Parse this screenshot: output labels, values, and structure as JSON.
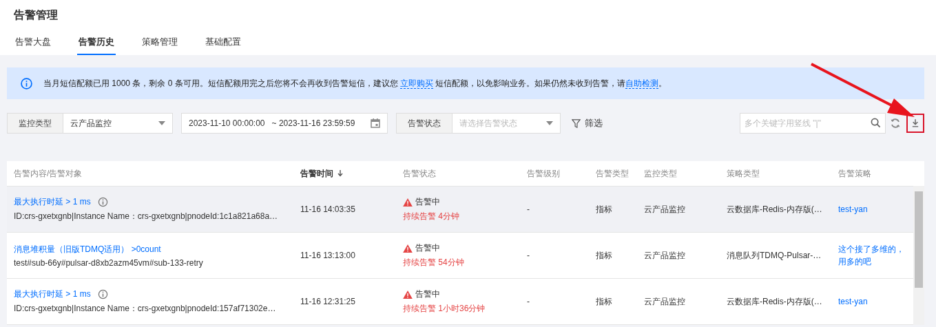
{
  "page_title": "告警管理",
  "tabs": [
    {
      "label": "告警大盘",
      "selected": false
    },
    {
      "label": "告警历史",
      "selected": true
    },
    {
      "label": "策略管理",
      "selected": false
    },
    {
      "label": "基础配置",
      "selected": false
    }
  ],
  "notice": {
    "text_1": "当月短信配额已用 1000 条，剩余 0 条可用。短信配额用完之后您将不会再收到告警短信，建议您 ",
    "link_1": "立即购买",
    "text_2": " 短信配额，以免影响业务。如果仍然未收到告警，请",
    "link_2": "自助检测",
    "text_3": "。"
  },
  "filters": {
    "monitor_type_label": "监控类型",
    "monitor_type_value": "云产品监控",
    "date_start": "2023-11-10 00:00:00",
    "date_separator": "~",
    "date_end": "2023-11-16 23:59:59",
    "status_label": "告警状态",
    "status_placeholder": "请选择告警状态",
    "filter_button": "筛选",
    "search_placeholder": "多个关键字用竖线 \"|\""
  },
  "table": {
    "columns": [
      {
        "label": "告警内容/告警对象",
        "sorted": false
      },
      {
        "label": "告警时间",
        "sorted": true
      },
      {
        "label": "告警状态",
        "sorted": false
      },
      {
        "label": "告警级别",
        "sorted": false
      },
      {
        "label": "告警类型",
        "sorted": false
      },
      {
        "label": "监控类型",
        "sorted": false
      },
      {
        "label": "策略类型",
        "sorted": false
      },
      {
        "label": "告警策略",
        "sorted": false
      }
    ],
    "rows": [
      {
        "hovered": true,
        "title": "最大执行时延 > 1 ms",
        "info": true,
        "object": "ID:crs-gxetxgnb|Instance Name：crs-gxetxgnb|pnodeId:1c1a821a68a…",
        "time": "11-16 14:03:35",
        "status": "告警中",
        "duration": "持续告警 4分钟",
        "level": "-",
        "alarm_type": "指标",
        "monitor_type": "云产品监控",
        "policy_type": "云数据库-Redis-内存版(…",
        "policy": "test-yan"
      },
      {
        "hovered": false,
        "title": "消息堆积量（旧版TDMQ适用） >0count",
        "info": false,
        "object": "test#sub-66y#pulsar-d8xb2azm45vm#sub-133-retry",
        "time": "11-16 13:13:00",
        "status": "告警中",
        "duration": "持续告警 54分钟",
        "level": "-",
        "alarm_type": "指标",
        "monitor_type": "云产品监控",
        "policy_type": "消息队列TDMQ-Pulsar-…",
        "policy": "这个接了多维的，用多的吧"
      },
      {
        "hovered": false,
        "title": "最大执行时延 > 1 ms",
        "info": true,
        "object": "ID:crs-gxetxgnb|Instance Name：crs-gxetxgnb|pnodeId:157af71302e…",
        "time": "11-16 12:31:25",
        "status": "告警中",
        "duration": "持续告警 1小时36分钟",
        "level": "-",
        "alarm_type": "指标",
        "monitor_type": "云产品监控",
        "policy_type": "云数据库-Redis-内存版(…",
        "policy": "test-yan"
      }
    ]
  }
}
